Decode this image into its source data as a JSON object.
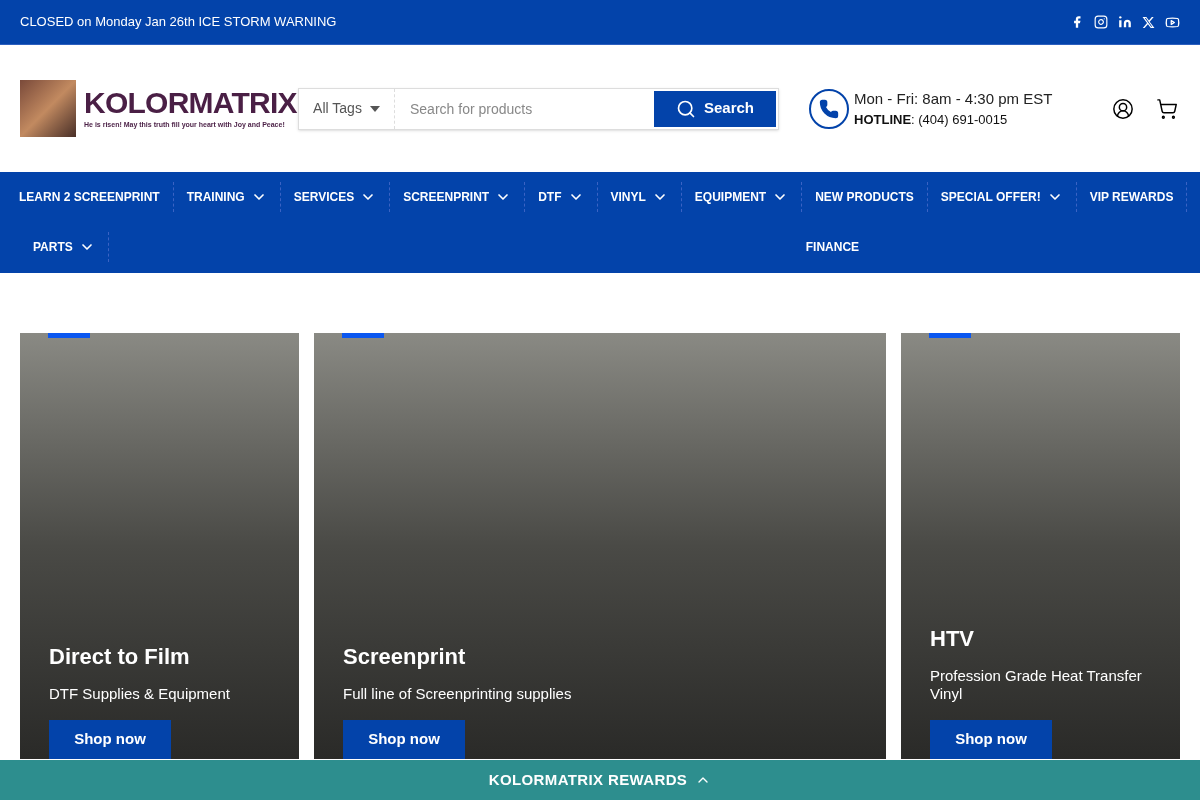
{
  "announcement": {
    "text": "CLOSED on Monday Jan 26th ICE STORM WARNING"
  },
  "logo": {
    "name": "KOLORMATRIX",
    "tagline": "He is risen! May this truth fill your heart with Joy and Peace!"
  },
  "search": {
    "category": "All Tags",
    "placeholder": "Search for products",
    "button": "Search"
  },
  "contact": {
    "hours": "Mon - Fri: 8am - 4:30 pm EST",
    "hotline_label": "HOTLINE",
    "hotline": ": (404) 691-0015"
  },
  "nav": {
    "items": [
      {
        "label": "LEARN 2 SCREENPRINT",
        "dropdown": false
      },
      {
        "label": "TRAINING",
        "dropdown": true
      },
      {
        "label": "SERVICES",
        "dropdown": true
      },
      {
        "label": "SCREENPRINT",
        "dropdown": true
      },
      {
        "label": "DTF",
        "dropdown": true
      },
      {
        "label": "VINYL",
        "dropdown": true
      },
      {
        "label": "EQUIPMENT",
        "dropdown": true
      },
      {
        "label": "NEW PRODUCTS",
        "dropdown": false
      },
      {
        "label": "SPECIAL OFFER!",
        "dropdown": true
      },
      {
        "label": "VIP REWARDS",
        "dropdown": false
      },
      {
        "label": "PARTS",
        "dropdown": true
      },
      {
        "label": "FINANCE",
        "dropdown": false
      }
    ]
  },
  "cards": [
    {
      "title": "Direct to Film",
      "subtitle": "DTF Supplies & Equipment",
      "button": "Shop now"
    },
    {
      "title": "Screenprint",
      "subtitle": "Full line of Screenprinting supplies",
      "button": "Shop now"
    },
    {
      "title": "HTV",
      "subtitle": "Profession Grade Heat Transfer Vinyl",
      "button": "Shop now"
    }
  ],
  "rewards_bar": {
    "label": "KOLORMATRIX REWARDS"
  }
}
